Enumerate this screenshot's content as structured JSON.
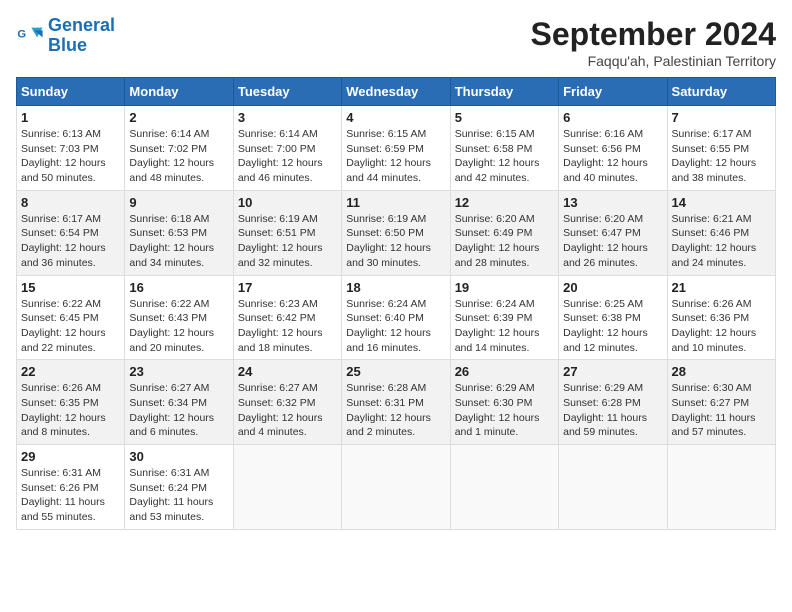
{
  "header": {
    "logo_line1": "General",
    "logo_line2": "Blue",
    "month_title": "September 2024",
    "subtitle": "Faqqu'ah, Palestinian Territory"
  },
  "weekdays": [
    "Sunday",
    "Monday",
    "Tuesday",
    "Wednesday",
    "Thursday",
    "Friday",
    "Saturday"
  ],
  "weeks": [
    [
      {
        "day": "1",
        "sunrise": "6:13 AM",
        "sunset": "7:03 PM",
        "daylight": "12 hours and 50 minutes."
      },
      {
        "day": "2",
        "sunrise": "6:14 AM",
        "sunset": "7:02 PM",
        "daylight": "12 hours and 48 minutes."
      },
      {
        "day": "3",
        "sunrise": "6:14 AM",
        "sunset": "7:00 PM",
        "daylight": "12 hours and 46 minutes."
      },
      {
        "day": "4",
        "sunrise": "6:15 AM",
        "sunset": "6:59 PM",
        "daylight": "12 hours and 44 minutes."
      },
      {
        "day": "5",
        "sunrise": "6:15 AM",
        "sunset": "6:58 PM",
        "daylight": "12 hours and 42 minutes."
      },
      {
        "day": "6",
        "sunrise": "6:16 AM",
        "sunset": "6:56 PM",
        "daylight": "12 hours and 40 minutes."
      },
      {
        "day": "7",
        "sunrise": "6:17 AM",
        "sunset": "6:55 PM",
        "daylight": "12 hours and 38 minutes."
      }
    ],
    [
      {
        "day": "8",
        "sunrise": "6:17 AM",
        "sunset": "6:54 PM",
        "daylight": "12 hours and 36 minutes."
      },
      {
        "day": "9",
        "sunrise": "6:18 AM",
        "sunset": "6:53 PM",
        "daylight": "12 hours and 34 minutes."
      },
      {
        "day": "10",
        "sunrise": "6:19 AM",
        "sunset": "6:51 PM",
        "daylight": "12 hours and 32 minutes."
      },
      {
        "day": "11",
        "sunrise": "6:19 AM",
        "sunset": "6:50 PM",
        "daylight": "12 hours and 30 minutes."
      },
      {
        "day": "12",
        "sunrise": "6:20 AM",
        "sunset": "6:49 PM",
        "daylight": "12 hours and 28 minutes."
      },
      {
        "day": "13",
        "sunrise": "6:20 AM",
        "sunset": "6:47 PM",
        "daylight": "12 hours and 26 minutes."
      },
      {
        "day": "14",
        "sunrise": "6:21 AM",
        "sunset": "6:46 PM",
        "daylight": "12 hours and 24 minutes."
      }
    ],
    [
      {
        "day": "15",
        "sunrise": "6:22 AM",
        "sunset": "6:45 PM",
        "daylight": "12 hours and 22 minutes."
      },
      {
        "day": "16",
        "sunrise": "6:22 AM",
        "sunset": "6:43 PM",
        "daylight": "12 hours and 20 minutes."
      },
      {
        "day": "17",
        "sunrise": "6:23 AM",
        "sunset": "6:42 PM",
        "daylight": "12 hours and 18 minutes."
      },
      {
        "day": "18",
        "sunrise": "6:24 AM",
        "sunset": "6:40 PM",
        "daylight": "12 hours and 16 minutes."
      },
      {
        "day": "19",
        "sunrise": "6:24 AM",
        "sunset": "6:39 PM",
        "daylight": "12 hours and 14 minutes."
      },
      {
        "day": "20",
        "sunrise": "6:25 AM",
        "sunset": "6:38 PM",
        "daylight": "12 hours and 12 minutes."
      },
      {
        "day": "21",
        "sunrise": "6:26 AM",
        "sunset": "6:36 PM",
        "daylight": "12 hours and 10 minutes."
      }
    ],
    [
      {
        "day": "22",
        "sunrise": "6:26 AM",
        "sunset": "6:35 PM",
        "daylight": "12 hours and 8 minutes."
      },
      {
        "day": "23",
        "sunrise": "6:27 AM",
        "sunset": "6:34 PM",
        "daylight": "12 hours and 6 minutes."
      },
      {
        "day": "24",
        "sunrise": "6:27 AM",
        "sunset": "6:32 PM",
        "daylight": "12 hours and 4 minutes."
      },
      {
        "day": "25",
        "sunrise": "6:28 AM",
        "sunset": "6:31 PM",
        "daylight": "12 hours and 2 minutes."
      },
      {
        "day": "26",
        "sunrise": "6:29 AM",
        "sunset": "6:30 PM",
        "daylight": "12 hours and 1 minute."
      },
      {
        "day": "27",
        "sunrise": "6:29 AM",
        "sunset": "6:28 PM",
        "daylight": "11 hours and 59 minutes."
      },
      {
        "day": "28",
        "sunrise": "6:30 AM",
        "sunset": "6:27 PM",
        "daylight": "11 hours and 57 minutes."
      }
    ],
    [
      {
        "day": "29",
        "sunrise": "6:31 AM",
        "sunset": "6:26 PM",
        "daylight": "11 hours and 55 minutes."
      },
      {
        "day": "30",
        "sunrise": "6:31 AM",
        "sunset": "6:24 PM",
        "daylight": "11 hours and 53 minutes."
      },
      null,
      null,
      null,
      null,
      null
    ]
  ]
}
